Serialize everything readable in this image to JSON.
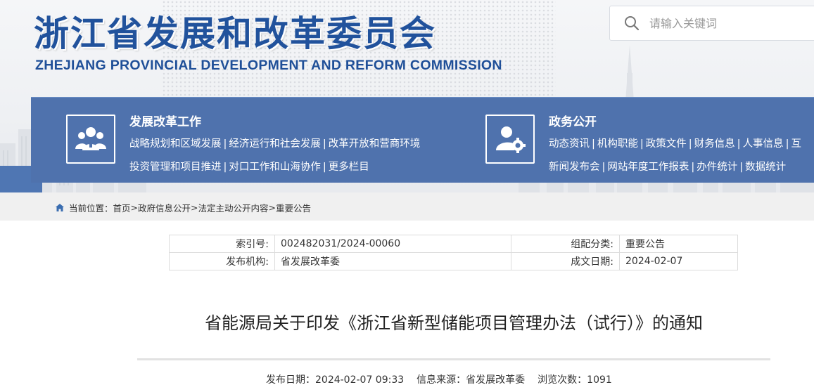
{
  "header": {
    "title_cn": "浙江省发展和改革委员会",
    "title_en": "ZHEJIANG PROVINCIAL DEVELOPMENT AND REFORM COMMISSION"
  },
  "search": {
    "placeholder": "请输入关键词",
    "icon": "search-icon"
  },
  "nav": {
    "block1": {
      "title": "发展改革工作",
      "icon": "people-icon",
      "row1": [
        "战略规划和区域发展",
        "经济运行和社会发展",
        "改革开放和营商环境"
      ],
      "row2": [
        "投资管理和项目推进",
        "对口工作和山海协作",
        "更多栏目"
      ]
    },
    "block2": {
      "title": "政务公开",
      "icon": "user-settings-icon",
      "row1": [
        "动态资讯",
        "机构职能",
        "政策文件",
        "财务信息",
        "人事信息",
        "互"
      ],
      "row2": [
        "新闻发布会",
        "网站年度工作报表",
        "办件统计",
        "数据统计"
      ]
    },
    "separator": "|"
  },
  "breadcrumb": {
    "prefix": "当前位置：",
    "items": [
      "首页",
      "政府信息公开",
      "法定主动公开内容",
      "重要公告"
    ],
    "separator": ">"
  },
  "meta": {
    "index_label": "索引号:",
    "index_value": "002482031/2024-00060",
    "category_label": "组配分类:",
    "category_value": "重要公告",
    "org_label": "发布机构:",
    "org_value": "省发展改革委",
    "date_label": "成文日期:",
    "date_value": "2024-02-07"
  },
  "article": {
    "title": "省能源局关于印发《浙江省新型储能项目管理办法（试行）》的通知",
    "publish_label": "发布日期：",
    "publish_value": "2024-02-07 09:33",
    "source_label": "信息来源：",
    "source_value": "省发展改革委",
    "views_label": "浏览次数：",
    "views_value": "1091"
  },
  "colors": {
    "brand": "#21529c",
    "nav_bg": "#4f72ad"
  }
}
